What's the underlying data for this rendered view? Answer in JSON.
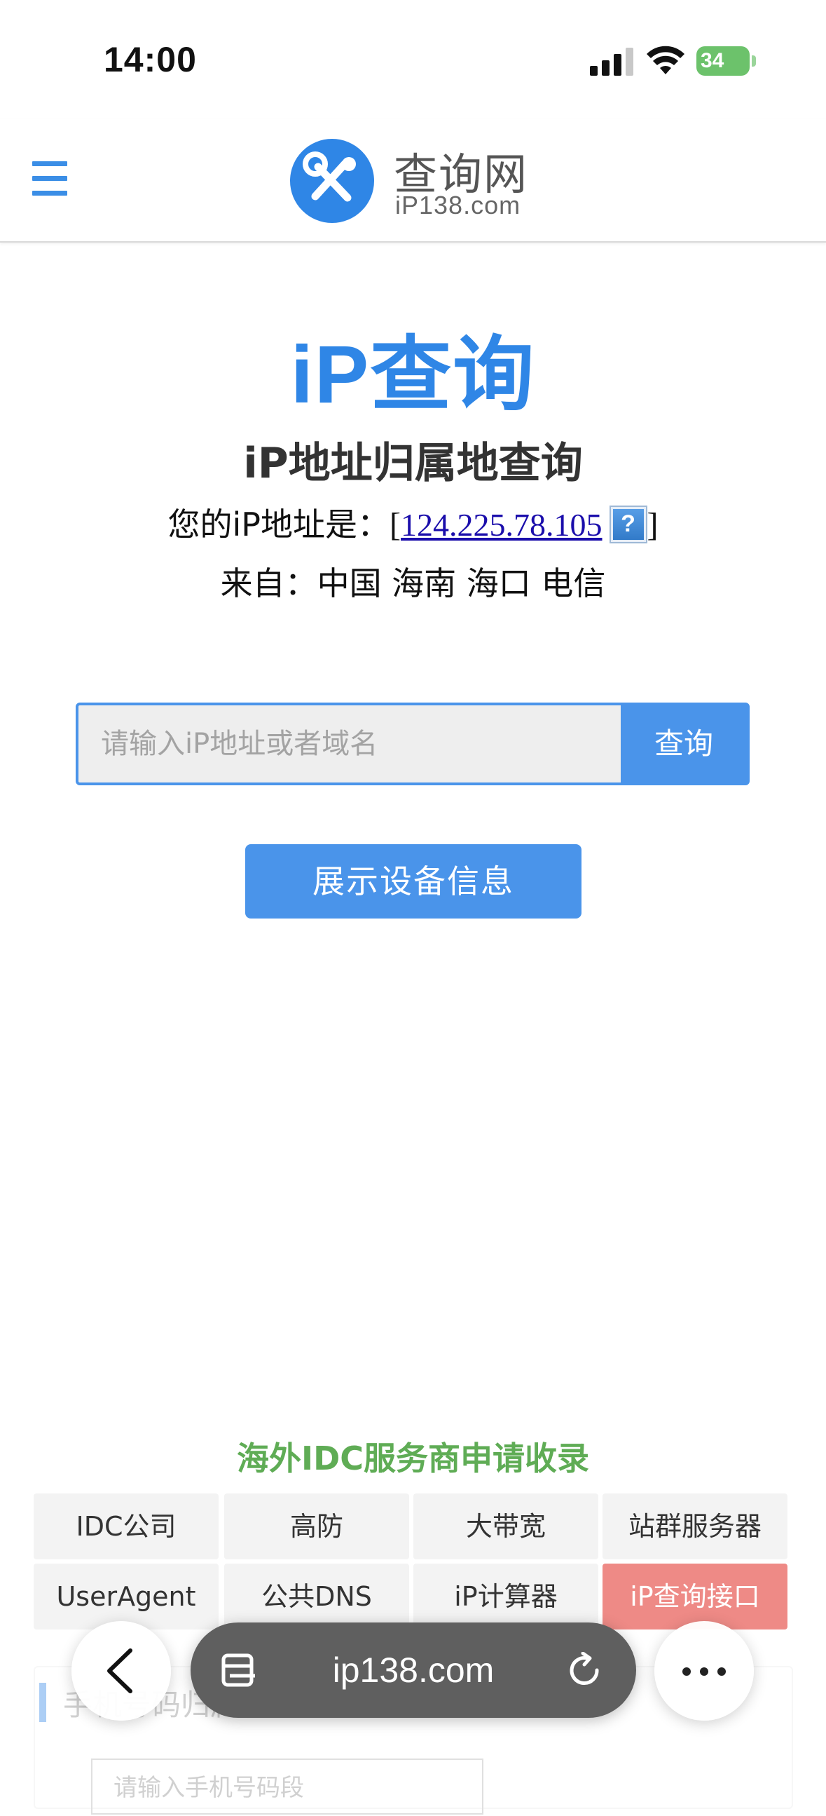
{
  "status_bar": {
    "time": "14:00",
    "battery": "34"
  },
  "header": {
    "logo_title": "查询网",
    "logo_subtitle": "iP138.com"
  },
  "main": {
    "title": "iP查询",
    "subtitle": "iP地址归属地查询",
    "ip_label": "您的iP地址是：",
    "ip_address": "124.225.78.105",
    "help_symbol": "?",
    "location": "来自：中国 海南 海口 电信"
  },
  "search": {
    "placeholder": "请输入iP地址或者域名",
    "button_label": "查询"
  },
  "device_button_label": "展示设备信息",
  "idc": {
    "title": "海外IDC服务商申请收录",
    "links": [
      {
        "label": "IDC公司"
      },
      {
        "label": "高防"
      },
      {
        "label": "大带宽"
      },
      {
        "label": "站群服务器"
      },
      {
        "label": "UserAgent"
      },
      {
        "label": "公共DNS"
      },
      {
        "label": "iP计算器"
      },
      {
        "label": "iP查询接口"
      }
    ]
  },
  "faded": {
    "title": "手机号码归属地",
    "input_placeholder": "请输入手机号码段"
  },
  "browser_bar": {
    "url": "ip138.com"
  },
  "colors": {
    "brand_blue": "#4a94ea",
    "title_blue": "#2f86e6",
    "idc_green": "#5fac55",
    "highlight_red": "#ee8a86",
    "link_color": "#1a0dab"
  }
}
